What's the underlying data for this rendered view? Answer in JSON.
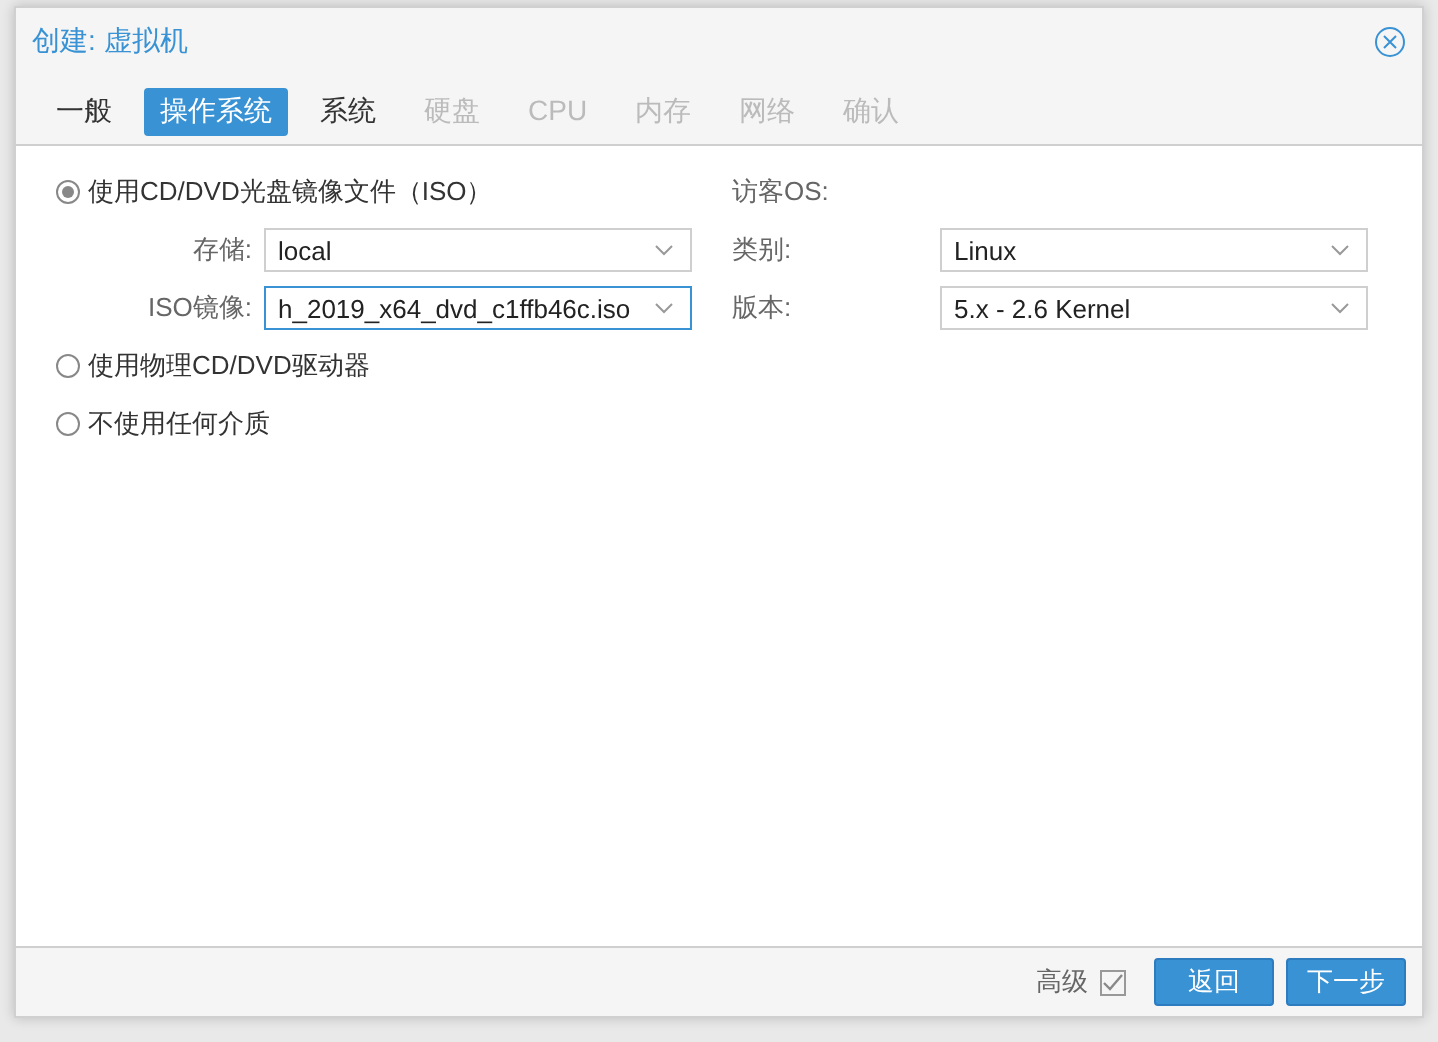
{
  "window": {
    "title": "创建: 虚拟机"
  },
  "tabs": [
    {
      "label": "一般",
      "selected": false,
      "disabled": false
    },
    {
      "label": "操作系统",
      "selected": true,
      "disabled": false
    },
    {
      "label": "系统",
      "selected": false,
      "disabled": false
    },
    {
      "label": "硬盘",
      "selected": false,
      "disabled": true
    },
    {
      "label": "CPU",
      "selected": false,
      "disabled": true
    },
    {
      "label": "内存",
      "selected": false,
      "disabled": true
    },
    {
      "label": "网络",
      "selected": false,
      "disabled": true
    },
    {
      "label": "确认",
      "selected": false,
      "disabled": true
    }
  ],
  "media": [
    {
      "label": "使用CD/DVD光盘镜像文件（ISO）",
      "selected": true,
      "fields": [
        {
          "label": "存储:",
          "value": "local",
          "focused": false
        },
        {
          "label": "ISO镜像:",
          "value": "h_2019_x64_dvd_c1ffb46c.iso",
          "focused": true
        }
      ]
    },
    {
      "label": "使用物理CD/DVD驱动器",
      "selected": false
    },
    {
      "label": "不使用任何介质",
      "selected": false
    }
  ],
  "guest_os": {
    "heading": "访客OS:",
    "fields": [
      {
        "label": "类别:",
        "value": "Linux",
        "focused": false
      },
      {
        "label": "版本:",
        "value": "5.x - 2.6 Kernel",
        "focused": false
      }
    ]
  },
  "footer": {
    "advanced": {
      "label": "高级",
      "checked": true
    },
    "buttons": [
      "返回",
      "下一步"
    ]
  }
}
